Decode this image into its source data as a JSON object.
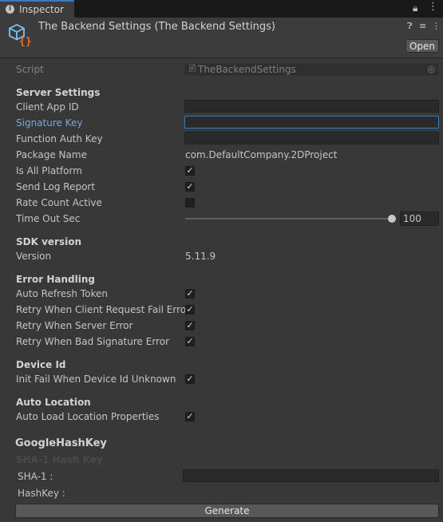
{
  "tab": {
    "label": "Inspector"
  },
  "header": {
    "title": "The Backend Settings (The Backend Settings)",
    "open_label": "Open"
  },
  "script": {
    "label": "Script",
    "value": "TheBackendSettings"
  },
  "server_settings": {
    "heading": "Server Settings",
    "client_app_id": "Client App ID",
    "signature_key": "Signature Key",
    "function_auth_key": "Function Auth Key",
    "package_name_label": "Package Name",
    "package_name_value": "com.DefaultCompany.2DProject",
    "is_all_platform": "Is All Platform",
    "send_log_report": "Send Log Report",
    "rate_count_active": "Rate Count Active",
    "time_out_sec": "Time Out Sec",
    "time_out_value": "100",
    "time_out_fraction": 1.0
  },
  "sdk": {
    "heading": "SDK version",
    "version_label": "Version",
    "version_value": "5.11.9"
  },
  "error_handling": {
    "heading": "Error Handling",
    "auto_refresh_token": "Auto Refresh Token",
    "retry_client": "Retry When Client Request Fail Error",
    "retry_server": "Retry When Server Error",
    "retry_bad_signature": "Retry When Bad Signature Error"
  },
  "device_id": {
    "heading": "Device Id",
    "init_fail": "Init Fail When Device Id Unknown"
  },
  "auto_location": {
    "heading": "Auto Location",
    "auto_load": "Auto Load Location Properties"
  },
  "google": {
    "heading": "GoogleHashKey",
    "faded_label": "SHA-1 Hash Key",
    "sha1_label": "SHA-1 :",
    "hashkey_label": "HashKey :",
    "generate_label": "Generate"
  },
  "checkbox_mark": "✓",
  "colors": {
    "accent": "#3a79bb",
    "focus_label": "#7ba4dc",
    "background": "#383838"
  }
}
